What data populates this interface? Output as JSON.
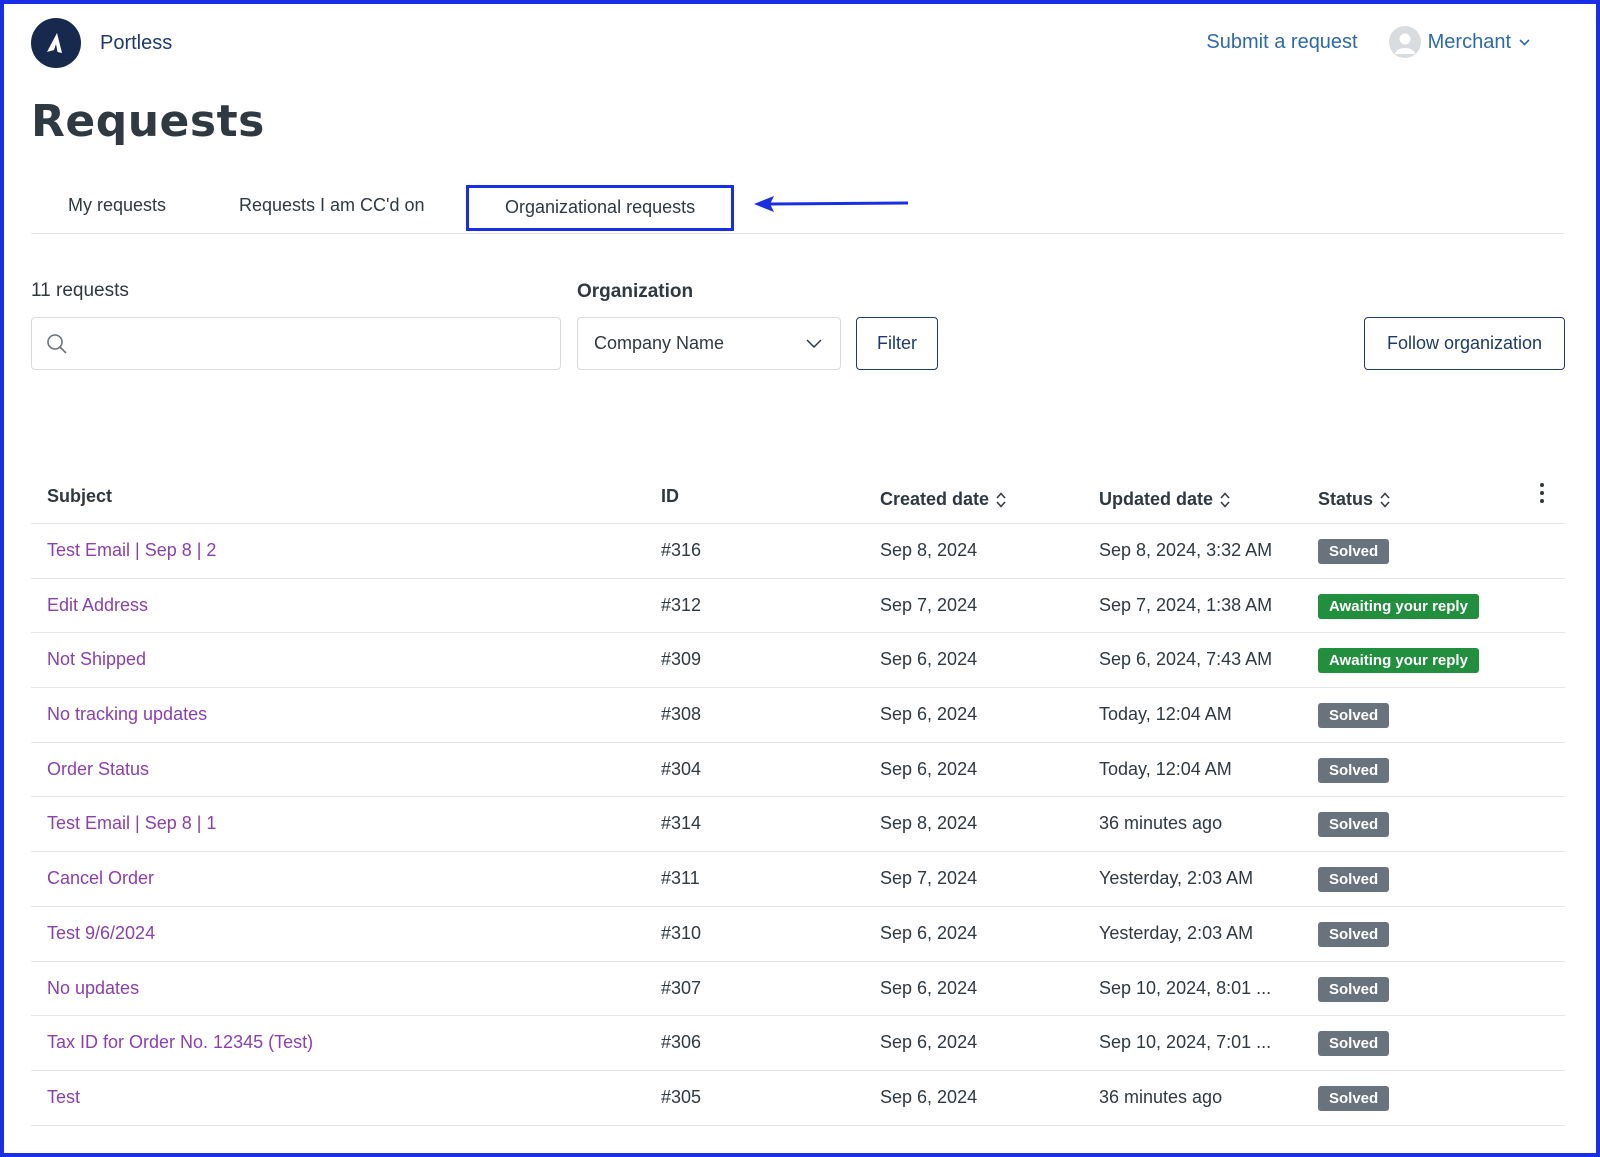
{
  "header": {
    "brand_name": "Portless",
    "submit_link": "Submit a request",
    "user_name": "Merchant"
  },
  "page_title": "Requests",
  "tabs": [
    {
      "label": "My requests",
      "active": false
    },
    {
      "label": "Requests I am CC'd on",
      "active": false
    },
    {
      "label": "Organizational requests",
      "active": true
    }
  ],
  "filters": {
    "request_count": "11 requests",
    "search_placeholder": "",
    "organization_label": "Organization",
    "organization_value": "Company Name",
    "filter_button": "Filter",
    "follow_button": "Follow organization"
  },
  "table": {
    "columns": {
      "subject": "Subject",
      "id": "ID",
      "created": "Created date",
      "updated": "Updated date",
      "status": "Status"
    },
    "rows": [
      {
        "subject": "Test Email | Sep 8 | 2",
        "id": "#316",
        "created": "Sep 8, 2024",
        "updated": "Sep 8, 2024, 3:32 AM",
        "status": "Solved"
      },
      {
        "subject": "Edit Address",
        "id": "#312",
        "created": "Sep 7, 2024",
        "updated": "Sep 7, 2024, 1:38 AM",
        "status": "Awaiting your reply"
      },
      {
        "subject": "Not Shipped",
        "id": "#309",
        "created": "Sep 6, 2024",
        "updated": "Sep 6, 2024, 7:43 AM",
        "status": "Awaiting your reply"
      },
      {
        "subject": "No tracking updates",
        "id": "#308",
        "created": "Sep 6, 2024",
        "updated": "Today, 12:04 AM",
        "status": "Solved"
      },
      {
        "subject": "Order Status",
        "id": "#304",
        "created": "Sep 6, 2024",
        "updated": "Today, 12:04 AM",
        "status": "Solved"
      },
      {
        "subject": "Test Email | Sep 8 | 1",
        "id": "#314",
        "created": "Sep 8, 2024",
        "updated": "36 minutes ago",
        "status": "Solved"
      },
      {
        "subject": "Cancel Order",
        "id": "#311",
        "created": "Sep 7, 2024",
        "updated": "Yesterday, 2:03 AM",
        "status": "Solved"
      },
      {
        "subject": "Test 9/6/2024",
        "id": "#310",
        "created": "Sep 6, 2024",
        "updated": "Yesterday, 2:03 AM",
        "status": "Solved"
      },
      {
        "subject": "No updates",
        "id": "#307",
        "created": "Sep 6, 2024",
        "updated": "Sep 10, 2024, 8:01 ...",
        "status": "Solved"
      },
      {
        "subject": "Tax ID for Order No. 12345 (Test)",
        "id": "#306",
        "created": "Sep 6, 2024",
        "updated": "Sep 10, 2024, 7:01 ...",
        "status": "Solved"
      },
      {
        "subject": "Test",
        "id": "#305",
        "created": "Sep 6, 2024",
        "updated": "36 minutes ago",
        "status": "Solved"
      }
    ]
  },
  "colors": {
    "highlight": "#1a2ee6",
    "link_purple": "#8a3fb2",
    "link_blue": "#2c69b0",
    "solved": "#68737d",
    "awaiting": "#228f3f"
  }
}
